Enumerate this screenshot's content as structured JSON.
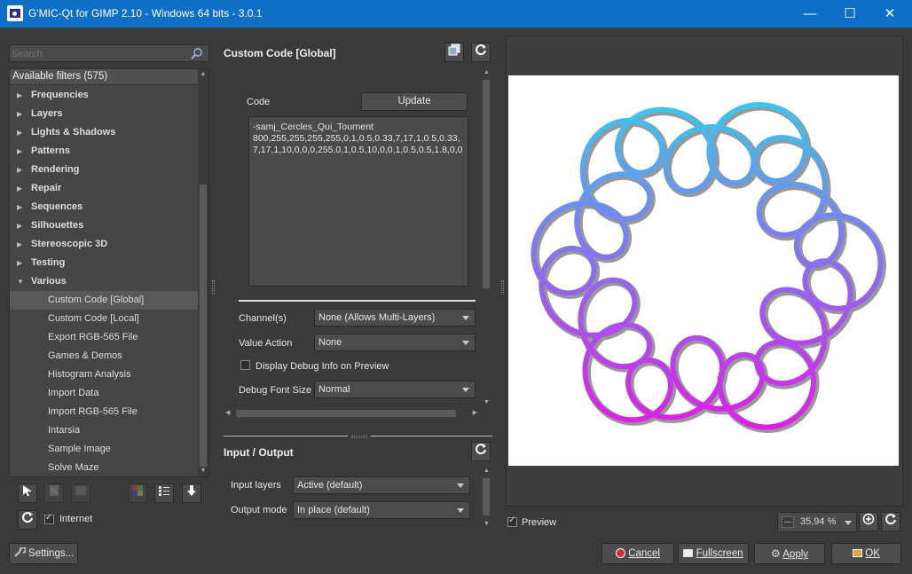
{
  "window": {
    "title": "G'MIC-Qt for GIMP 2.10 - Windows 64 bits - 3.0.1",
    "minimize_glyph": "—",
    "maximize_glyph": "☐",
    "close_glyph": "✕"
  },
  "left": {
    "search_placeholder": "Search",
    "filters_header": "Available filters (575)",
    "categories": [
      {
        "label": "Frequencies"
      },
      {
        "label": "Layers"
      },
      {
        "label": "Lights & Shadows"
      },
      {
        "label": "Patterns"
      },
      {
        "label": "Rendering"
      },
      {
        "label": "Repair"
      },
      {
        "label": "Sequences"
      },
      {
        "label": "Silhouettes"
      },
      {
        "label": "Stereoscopic 3D"
      },
      {
        "label": "Testing"
      },
      {
        "label": "Various"
      }
    ],
    "various_items": [
      "Custom Code [Global]",
      "Custom Code [Local]",
      "Export RGB-565 File",
      "Games & Demos",
      "Histogram Analysis",
      "Import Data",
      "Import RGB-565 File",
      "Intarsia",
      "Sample Image",
      "Solve Maze"
    ],
    "selected_item": "Custom Code [Global]",
    "internet_label": "Internet",
    "settings_label": "Settings..."
  },
  "filter": {
    "title": "Custom Code [Global]",
    "code_label": "Code",
    "update_label": "Update",
    "code_value": "-samj_Cercles_Qui_Tournent\n800,255,255,255,255,0,1,0.5,0.33,7,17,1,0.5,0.33,7,17,1,10,0,0,0,255,0,1,0.5,10,0,0,1,0.5,0.5,1.8,0,0",
    "channels_label": "Channel(s)",
    "channels_value": "None (Allows Multi-Layers)",
    "value_action_label": "Value Action",
    "value_action_value": "None",
    "debug_info_label": "Display Debug Info on Preview",
    "debug_font_label": "Debug Font Size",
    "debug_font_value": "Normal"
  },
  "io": {
    "title": "Input / Output",
    "input_layers_label": "Input layers",
    "input_layers_value": "Active (default)",
    "output_mode_label": "Output mode",
    "output_mode_value": "In place (default)"
  },
  "preview": {
    "preview_label": "Preview",
    "zoom": "35,94 %",
    "colors": {
      "top": "#38c8ee",
      "mid": "#8a6ef0",
      "bottom": "#e01ee6"
    }
  },
  "actions": {
    "cancel": "Cancel",
    "fullscreen": "Fullscreen",
    "apply": "Apply",
    "ok": "OK"
  }
}
